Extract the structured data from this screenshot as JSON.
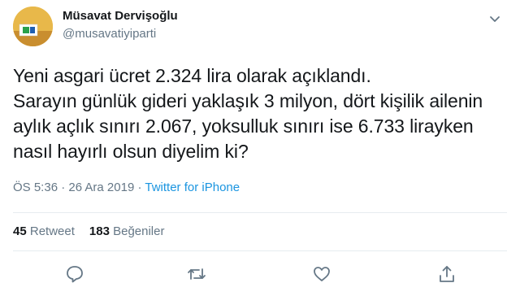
{
  "author": {
    "name": "Müsavat Dervişoğlu",
    "handle": "@musavatiyiparti"
  },
  "tweet": {
    "text": "Yeni asgari ücret 2.324 lira olarak açıklandı.\nSarayın günlük gideri yaklaşık 3 milyon, dört kişilik ailenin aylık açlık sınırı 2.067, yoksulluk sınırı ise 6.733 lirayken nasıl hayırlı olsun diyelim ki?",
    "time": "ÖS 5:36",
    "date": "26 Ara 2019",
    "separator": "·",
    "source": "Twitter for iPhone"
  },
  "stats": {
    "retweets_count": "45",
    "retweets_label": "Retweet",
    "likes_count": "183",
    "likes_label": "Beğeniler"
  },
  "icons": {
    "more": "chevron-down-icon",
    "reply": "reply-icon",
    "retweet": "retweet-icon",
    "like": "heart-icon",
    "share": "share-icon"
  },
  "colors": {
    "text": "#14171a",
    "secondary": "#657786",
    "link": "#1b95e0",
    "divider": "#e6ecf0"
  }
}
